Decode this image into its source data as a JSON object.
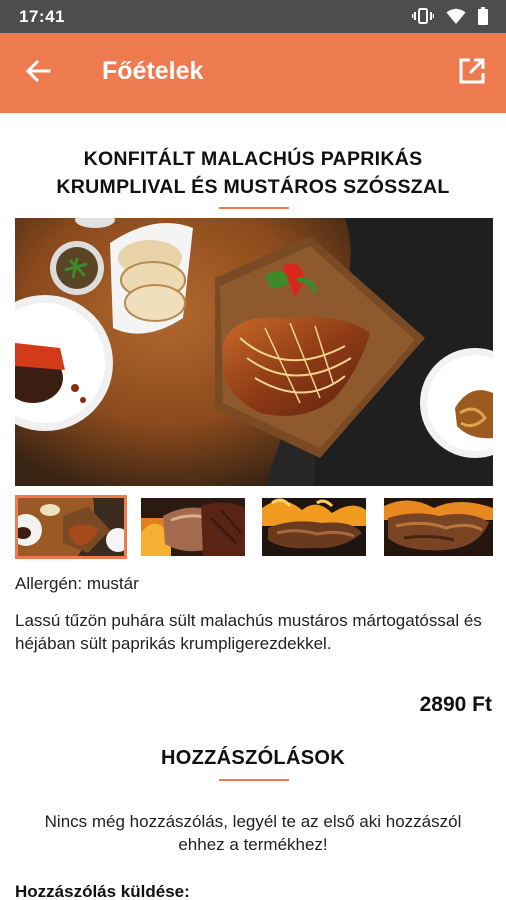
{
  "status_bar": {
    "time": "17:41",
    "icons": [
      "vibrate-icon",
      "wifi-icon",
      "battery-icon"
    ]
  },
  "app_bar": {
    "title": "Főételek",
    "back_icon": "arrow-left-icon",
    "share_icon": "open-external-icon",
    "color": "#ee7a50"
  },
  "product": {
    "title": "KONFITÁLT MALACHÚS PAPRIKÁS KRUMPLIVAL ÉS MUSTÁROS SZÓSSZAL",
    "allergen": "Allergén: mustár",
    "description": "Lassú tűzön puhára sült malachús mustáros mártogatóssal és héjában sült paprikás krumpligerezdekkel.",
    "price": "2890 Ft",
    "selected_thumbnail": 1,
    "thumbnail_count": 4
  },
  "comments": {
    "title": "HOZZÁSZÓLÁSOK",
    "empty_text": "Nincs még hozzászólás, legyél te az első aki hozzászól ehhez a termékhez!",
    "send_label": "Hozzászólás küldése:"
  }
}
